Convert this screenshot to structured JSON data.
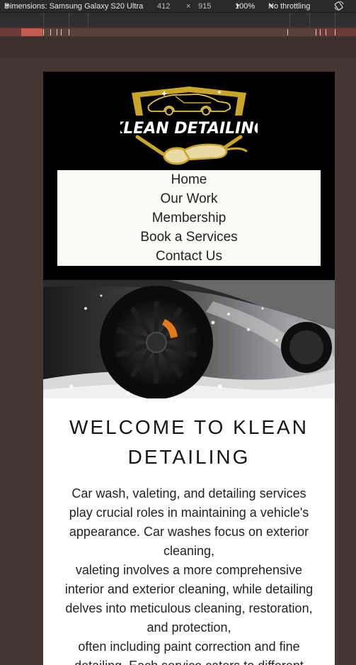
{
  "devtools": {
    "dimensions_label": "Dimensions: Samsung Galaxy S20 Ultra",
    "width": "412",
    "times": "×",
    "height": "915",
    "zoom": "100%",
    "throttling": "No throttling",
    "dropdown_arrow": "▼"
  },
  "site": {
    "logo_text": "KLEAN DETAILING",
    "nav": [
      {
        "label": "Home"
      },
      {
        "label": "Our Work"
      },
      {
        "label": "Membership"
      },
      {
        "label": "Book a Services"
      },
      {
        "label": "Contact Us"
      }
    ],
    "heading_line1": "WELCOME TO KLEAN",
    "heading_line2": "DETAILING",
    "intro_lines": [
      "Car wash, valeting, and detailing services",
      "play crucial roles in maintaining a vehicle's",
      "appearance. Car washes focus on exterior",
      "cleaning,",
      "valeting involves a more comprehensive",
      "interior and exterior cleaning, while detailing",
      "delves into meticulous cleaning, restoration,",
      "and protection,",
      "often including paint correction and fine",
      "detailing. Each service caters to different"
    ],
    "colors": {
      "header_bg": "#000000",
      "logo_gold": "#c9a62a",
      "nav_bg": "#fbfbf6",
      "page_bg": "#433633"
    }
  }
}
